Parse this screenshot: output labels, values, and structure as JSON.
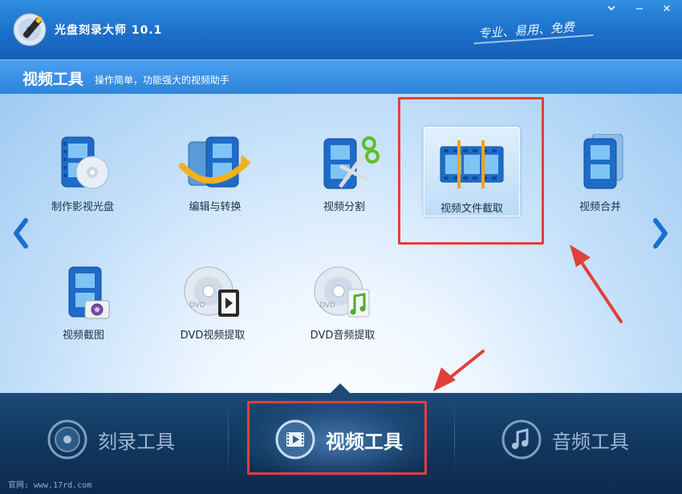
{
  "app": {
    "title": "光盘刻录大师 10.1",
    "slogan": "专业、易用、免费"
  },
  "window_controls": {
    "minimize": "−",
    "close": "✕"
  },
  "section": {
    "title": "视频工具",
    "subtitle": "操作简单，功能强大的视频助手"
  },
  "tools": [
    {
      "label": "制作影视光盘",
      "icon": "film-disc-icon"
    },
    {
      "label": "编辑与转换",
      "icon": "film-convert-icon"
    },
    {
      "label": "视频分割",
      "icon": "film-scissors-icon"
    },
    {
      "label": "视频文件截取",
      "icon": "film-trim-icon"
    },
    {
      "label": "视频合并",
      "icon": "film-merge-icon"
    },
    {
      "label": "视频截图",
      "icon": "film-camera-icon"
    },
    {
      "label": "DVD视频提取",
      "icon": "dvd-video-icon"
    },
    {
      "label": "DVD音频提取",
      "icon": "dvd-audio-icon"
    }
  ],
  "bottom_tabs": [
    {
      "label": "刻录工具",
      "icon": "disc-icon"
    },
    {
      "label": "视频工具",
      "icon": "film-icon",
      "active": true
    },
    {
      "label": "音频工具",
      "icon": "music-note-icon"
    }
  ],
  "footer": {
    "website": "官网: www.17rd.com"
  },
  "colors": {
    "accent": "#1b6fca",
    "annotation": "#e0403a",
    "text": "#1e2f44"
  }
}
